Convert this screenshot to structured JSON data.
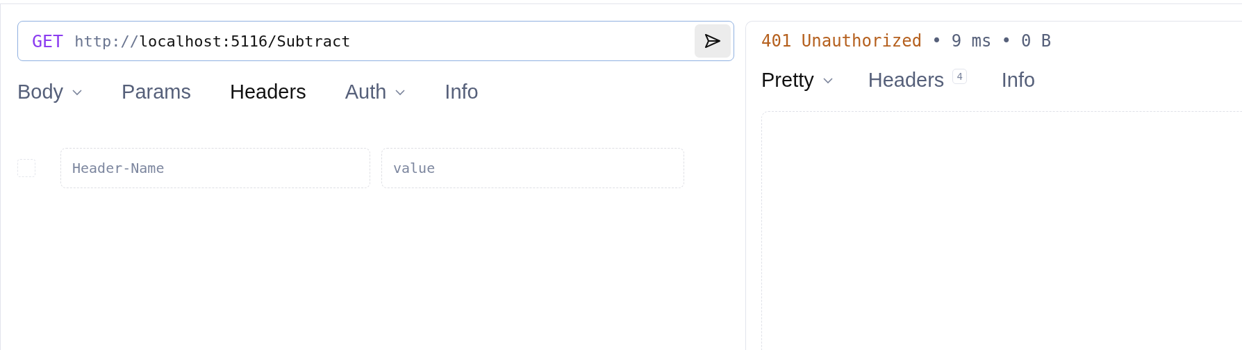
{
  "request": {
    "method": "GET",
    "url_scheme": "http://",
    "url_rest": "localhost:5116/Subtract"
  },
  "request_tabs": [
    {
      "label": "Body",
      "dropdown": true,
      "selected": false
    },
    {
      "label": "Params",
      "dropdown": false,
      "selected": false
    },
    {
      "label": "Headers",
      "dropdown": false,
      "selected": true
    },
    {
      "label": "Auth",
      "dropdown": true,
      "selected": false
    },
    {
      "label": "Info",
      "dropdown": false,
      "selected": false
    }
  ],
  "header_rows": [
    {
      "checked": false,
      "name_placeholder": "Header-Name",
      "value_placeholder": "value"
    }
  ],
  "response": {
    "status": "401 Unauthorized",
    "separator": "•",
    "time": "9 ms",
    "size": "0 B"
  },
  "response_tabs": [
    {
      "label": "Pretty",
      "dropdown": true,
      "selected": true
    },
    {
      "label": "Headers",
      "dropdown": false,
      "selected": false,
      "count": "4"
    },
    {
      "label": "Info",
      "dropdown": false,
      "selected": false
    }
  ]
}
